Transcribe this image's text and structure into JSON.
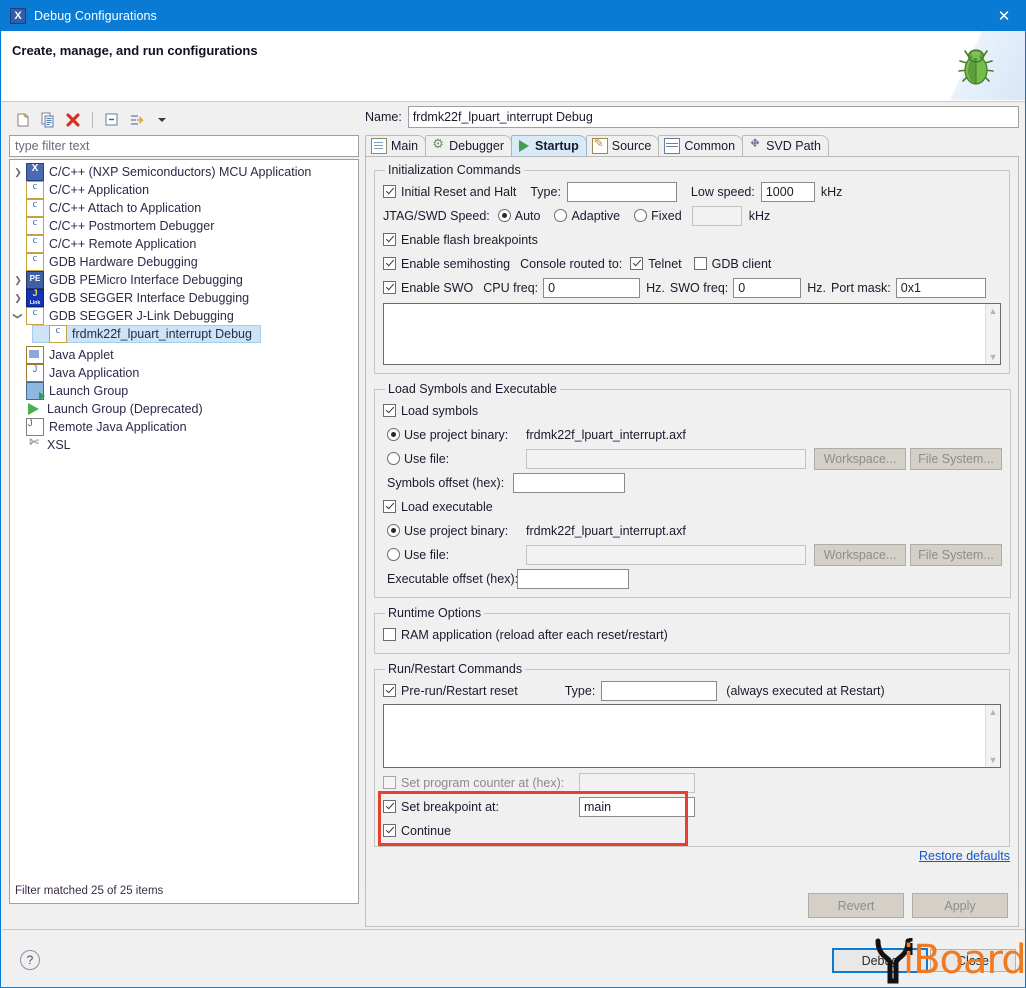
{
  "window": {
    "title": "Debug Configurations",
    "icon": "eclipse-x-icon",
    "close_label": "✕"
  },
  "header": {
    "title": "Create, manage, and run configurations",
    "decor_icon": "green-bug-icon"
  },
  "left_panel": {
    "toolbar": [
      {
        "name": "new-configuration-icon",
        "glyph": "❐"
      },
      {
        "name": "duplicate-configuration-icon",
        "glyph": "❐"
      },
      {
        "name": "delete-configuration-icon",
        "glyph": "✕"
      },
      {
        "name": "collapse-all-icon",
        "glyph": "⊟"
      },
      {
        "name": "filter-icon",
        "glyph": "⇒"
      },
      {
        "name": "view-menu-chevron-icon",
        "glyph": "▾"
      }
    ],
    "filter": {
      "value": "",
      "placeholder": "type filter text"
    },
    "tree": [
      {
        "label": "C/C++ (NXP Semiconductors) MCU Application",
        "icon": "x-app-icon",
        "expandable": true,
        "expanded": false,
        "indent": 0,
        "selected": false
      },
      {
        "label": "C/C++ Application",
        "icon": "c-file-icon",
        "expandable": false,
        "expanded": false,
        "indent": 0,
        "selected": false
      },
      {
        "label": "C/C++ Attach to Application",
        "icon": "c-file-icon",
        "expandable": false,
        "expanded": false,
        "indent": 0,
        "selected": false
      },
      {
        "label": "C/C++ Postmortem Debugger",
        "icon": "c-file-icon",
        "expandable": false,
        "expanded": false,
        "indent": 0,
        "selected": false
      },
      {
        "label": "C/C++ Remote Application",
        "icon": "c-file-icon",
        "expandable": false,
        "expanded": false,
        "indent": 0,
        "selected": false
      },
      {
        "label": "GDB Hardware Debugging",
        "icon": "c-file-icon",
        "expandable": false,
        "expanded": false,
        "indent": 0,
        "selected": false
      },
      {
        "label": "GDB PEMicro Interface Debugging",
        "icon": "pemicro-icon",
        "expandable": true,
        "expanded": false,
        "indent": 0,
        "selected": false
      },
      {
        "label": "GDB SEGGER Interface Debugging",
        "icon": "jlink-icon",
        "expandable": true,
        "expanded": false,
        "indent": 0,
        "selected": false
      },
      {
        "label": "GDB SEGGER J-Link Debugging",
        "icon": "c-file-icon",
        "expandable": true,
        "expanded": true,
        "indent": 0,
        "selected": false
      },
      {
        "label": "frdmk22f_lpuart_interrupt Debug",
        "icon": "c-file-icon",
        "expandable": false,
        "expanded": false,
        "indent": 1,
        "selected": true
      },
      {
        "label": "Java Applet",
        "icon": "java-applet-icon",
        "expandable": false,
        "expanded": false,
        "indent": 0,
        "selected": false
      },
      {
        "label": "Java Application",
        "icon": "java-app-icon",
        "expandable": false,
        "expanded": false,
        "indent": 0,
        "selected": false
      },
      {
        "label": "Launch Group",
        "icon": "launch-group-icon",
        "expandable": false,
        "expanded": false,
        "indent": 0,
        "selected": false
      },
      {
        "label": "Launch Group (Deprecated)",
        "icon": "play-icon",
        "expandable": false,
        "expanded": false,
        "indent": 0,
        "selected": false
      },
      {
        "label": "Remote Java Application",
        "icon": "remote-java-icon",
        "expandable": false,
        "expanded": false,
        "indent": 0,
        "selected": false
      },
      {
        "label": "XSL",
        "icon": "xsl-icon",
        "expandable": false,
        "expanded": false,
        "indent": 0,
        "selected": false
      }
    ],
    "status": "Filter matched 25 of 25 items"
  },
  "config": {
    "name_label": "Name:",
    "name_value": "frdmk22f_lpuart_interrupt Debug",
    "tabs": [
      {
        "label": "Main",
        "icon": "main-tab-icon",
        "active": false
      },
      {
        "label": "Debugger",
        "icon": "debugger-tab-icon",
        "active": false
      },
      {
        "label": "Startup",
        "icon": "startup-tab-icon",
        "active": true
      },
      {
        "label": "Source",
        "icon": "source-tab-icon",
        "active": false
      },
      {
        "label": "Common",
        "icon": "common-tab-icon",
        "active": false
      },
      {
        "label": "SVD Path",
        "icon": "svd-path-tab-icon",
        "active": false
      }
    ]
  },
  "init_commands": {
    "legend": "Initialization Commands",
    "initial_reset_label": "Initial Reset and Halt",
    "initial_reset_checked": true,
    "type_label": "Type:",
    "type_value": "",
    "low_speed_label": "Low speed:",
    "low_speed_value": "1000",
    "low_speed_unit": "kHz",
    "jtag_label": "JTAG/SWD Speed:",
    "jtag_auto": "Auto",
    "jtag_adaptive": "Adaptive",
    "jtag_fixed": "Fixed",
    "jtag_selected": "Auto",
    "jtag_fixed_value": "",
    "jtag_fixed_unit": "kHz",
    "flash_bp_label": "Enable flash breakpoints",
    "flash_bp_checked": true,
    "semihosting_label": "Enable semihosting",
    "semihosting_checked": true,
    "console_label": "Console routed to:",
    "telnet_label": "Telnet",
    "telnet_checked": true,
    "gdb_client_label": "GDB client",
    "gdb_client_checked": false,
    "swo_label": "Enable SWO",
    "swo_checked": true,
    "cpu_freq_label": "CPU freq:",
    "cpu_freq_value": "0",
    "cpu_freq_unit": "Hz.",
    "swo_freq_label": "SWO freq:",
    "swo_freq_value": "0",
    "swo_freq_unit": "Hz.",
    "port_mask_label": "Port mask:",
    "port_mask_value": "0x1",
    "commands_text": ""
  },
  "load_section": {
    "legend": "Load Symbols and Executable",
    "load_symbols_label": "Load symbols",
    "load_symbols_checked": true,
    "sym_use_project_label": "Use project binary:",
    "sym_project_binary": "frdmk22f_lpuart_interrupt.axf",
    "sym_use_file_label": "Use file:",
    "sym_file_value": "",
    "sym_workspace_button": "Workspace...",
    "sym_filesystem_button": "File System...",
    "sym_offset_label": "Symbols offset (hex):",
    "sym_offset_value": "",
    "load_exec_label": "Load executable",
    "load_exec_checked": true,
    "exec_use_project_label": "Use project binary:",
    "exec_project_binary": "frdmk22f_lpuart_interrupt.axf",
    "exec_use_file_label": "Use file:",
    "exec_file_value": "",
    "exec_workspace_button": "Workspace...",
    "exec_filesystem_button": "File System...",
    "exec_offset_label": "Executable offset (hex):",
    "exec_offset_value": "",
    "sym_source_selected": "project",
    "exec_source_selected": "project"
  },
  "runtime_options": {
    "legend": "Runtime Options",
    "ram_app_label": "RAM application (reload after each reset/restart)",
    "ram_app_checked": false
  },
  "run_restart": {
    "legend": "Run/Restart Commands",
    "prerun_label": "Pre-run/Restart reset",
    "prerun_checked": true,
    "type_label": "Type:",
    "type_value": "",
    "always_note": "(always executed at Restart)",
    "commands_text": "",
    "set_pc_label": "Set program counter at (hex):",
    "set_pc_checked": false,
    "set_pc_value": "",
    "set_bp_label": "Set breakpoint at:",
    "set_bp_checked": true,
    "set_bp_value": "main",
    "continue_label": "Continue",
    "continue_checked": true,
    "highlight_color": "#e8402e"
  },
  "footer": {
    "restore_defaults": "Restore defaults",
    "revert_button": "Revert",
    "apply_button": "Apply",
    "help_icon": "help-question-icon",
    "debug_button": "Debug",
    "close_button": "Close"
  },
  "watermark": {
    "text": "iBoard",
    "mark": "Y",
    "color": "#f07a21"
  }
}
